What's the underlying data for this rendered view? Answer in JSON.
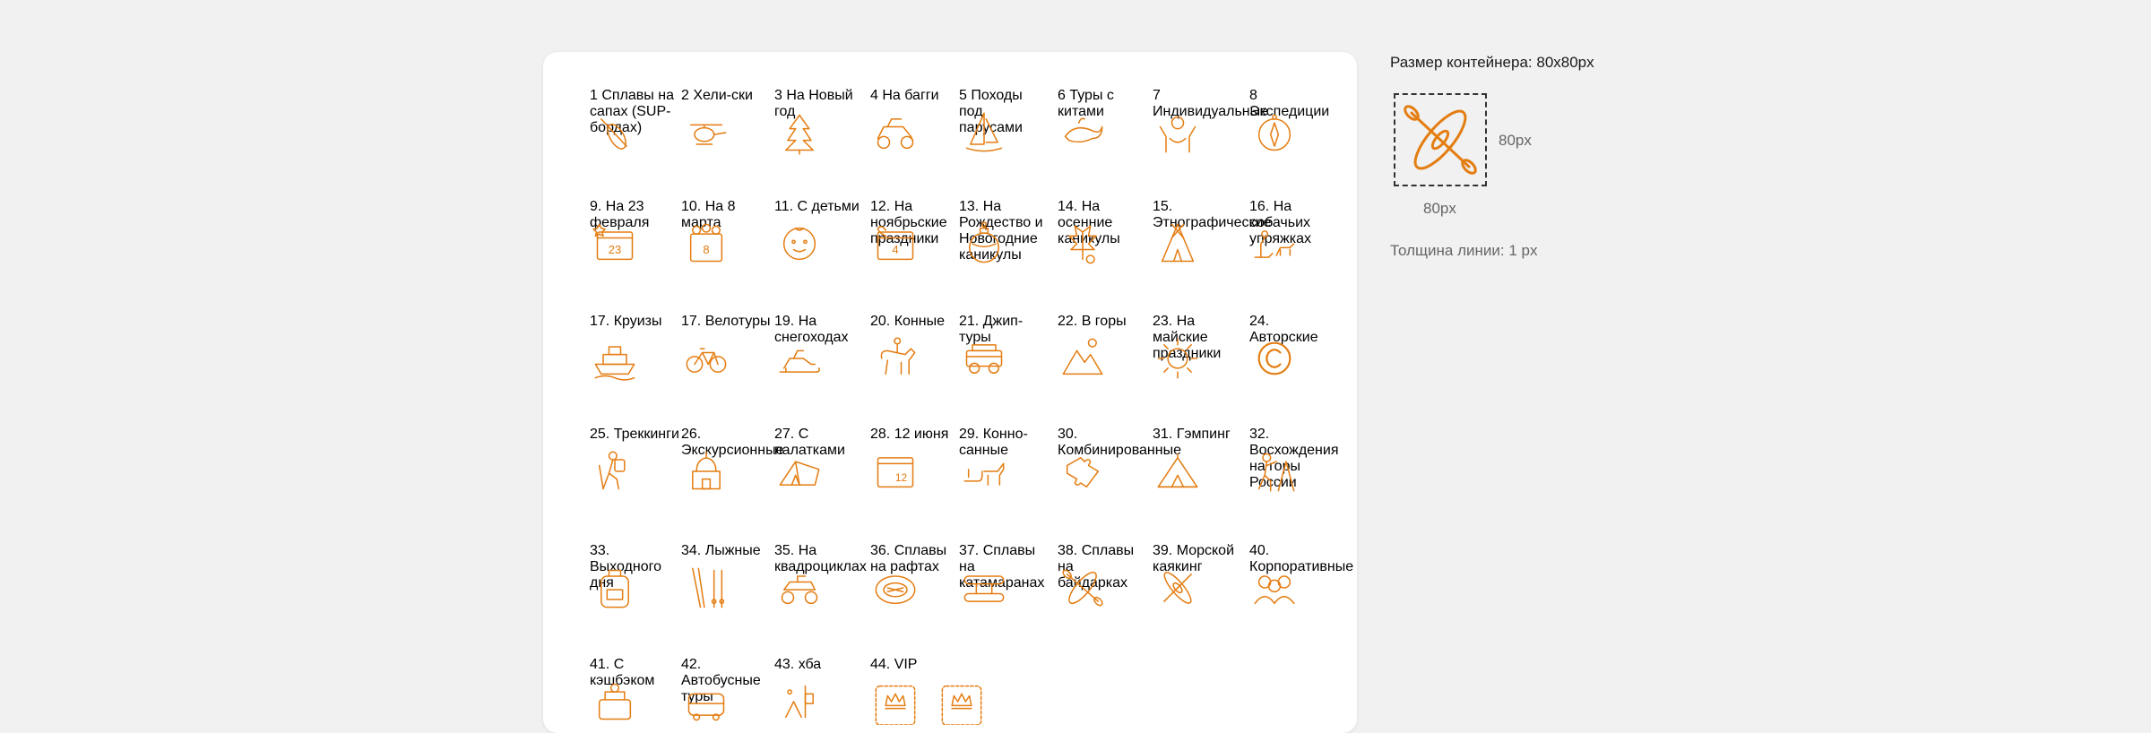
{
  "colors": {
    "accent": "#e47d12",
    "background": "#f0f1f0",
    "card": "#ffffff"
  },
  "items": [
    {
      "label": "1 Сплавы на сапах (SUP-бордах)",
      "icon": "sup-paddle-icon"
    },
    {
      "label": "2 Хели-ски",
      "icon": "helicopter-icon"
    },
    {
      "label": "3 На Новый год",
      "icon": "christmas-tree-icon"
    },
    {
      "label": "4 На багги",
      "icon": "buggy-icon"
    },
    {
      "label": "5 Походы под парусами",
      "icon": "sailboat-icon"
    },
    {
      "label": "6 Туры с китами",
      "icon": "whale-icon"
    },
    {
      "label": "7 Индивидуальные",
      "icon": "person-hands-icon"
    },
    {
      "label": "8 Экспедиции",
      "icon": "compass-icon"
    },
    {
      "label": "9. На 23 февраля",
      "icon": "calendar-23-icon"
    },
    {
      "label": "10. На 8 марта",
      "icon": "calendar-8-flowers-icon"
    },
    {
      "label": "11. С детьми",
      "icon": "baby-face-icon"
    },
    {
      "label": "12. На ноябрьские праздники",
      "icon": "calendar-4-icon"
    },
    {
      "label": "13. На Рождество и Новогодние каникулы",
      "icon": "christmas-ball-icon"
    },
    {
      "label": "14. На осенние каникулы",
      "icon": "autumn-leaf-icon"
    },
    {
      "label": "15. Этнографические",
      "icon": "tipi-icon"
    },
    {
      "label": "16. На собачьих упряжках",
      "icon": "dog-sled-icon"
    },
    {
      "label": "17. Круизы",
      "icon": "cruise-ship-icon"
    },
    {
      "label": "17. Велотуры",
      "icon": "bicycle-icon"
    },
    {
      "label": "19. На снегоходах",
      "icon": "snowmobile-icon"
    },
    {
      "label": "20. Конные",
      "icon": "horse-rider-icon"
    },
    {
      "label": "21. Джип-туры",
      "icon": "jeep-icon"
    },
    {
      "label": "22. В горы",
      "icon": "mountains-icon"
    },
    {
      "label": "23. На майские праздники",
      "icon": "sun-icon"
    },
    {
      "label": "24. Авторские",
      "icon": "copyright-icon"
    },
    {
      "label": "25. Треккинги",
      "icon": "hiker-icon"
    },
    {
      "label": "26. Экскурсионные",
      "icon": "temple-icon"
    },
    {
      "label": "27. С палатками",
      "icon": "tent-icon"
    },
    {
      "label": "28. 12 июня",
      "icon": "calendar-12-icon"
    },
    {
      "label": "29. Конно-санные",
      "icon": "horse-sleigh-icon"
    },
    {
      "label": "30. Комбинированные",
      "icon": "puzzle-icon"
    },
    {
      "label": "31. Гэмпинг",
      "icon": "glamping-tent-icon"
    },
    {
      "label": "32. Восхождения на горы России",
      "icon": "climber-icon"
    },
    {
      "label": "33. Выходного дня",
      "icon": "backpack-icon"
    },
    {
      "label": "34. Лыжные",
      "icon": "skis-icon"
    },
    {
      "label": "35. На квадроциклах",
      "icon": "atv-icon"
    },
    {
      "label": "36. Сплавы на рафтах",
      "icon": "raft-icon"
    },
    {
      "label": "37. Сплавы на катамаранах",
      "icon": "catamaran-icon"
    },
    {
      "label": "38. Сплавы на байдарках",
      "icon": "kayak-icon"
    },
    {
      "label": "39. Морской каякинг",
      "icon": "sea-kayak-icon"
    },
    {
      "label": "40. Корпоративные",
      "icon": "group-people-icon"
    },
    {
      "label": "41. С кэшбэком",
      "icon": "cashback-icon"
    },
    {
      "label": "42. Автобусные туры",
      "icon": "bus-icon"
    },
    {
      "label": "43. хба",
      "icon": "misc-icon"
    },
    {
      "label": "44. VIP",
      "icon": "vip-crown-icon"
    }
  ],
  "spec": {
    "title": "Размер контейнера: 80x80px",
    "width_label": "80px",
    "height_label": "80px",
    "line_label": "Толщина линии: 1 px",
    "icon": "kayak-icon"
  }
}
